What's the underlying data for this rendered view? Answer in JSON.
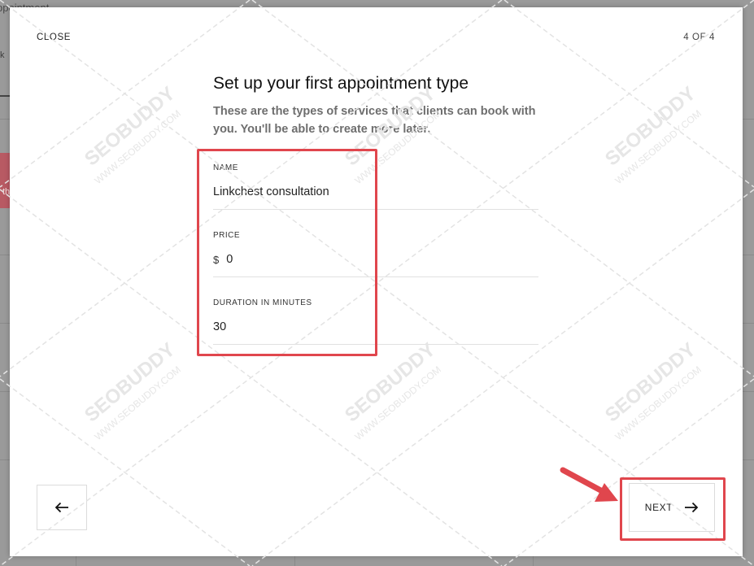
{
  "background": {
    "page_title": "ppointment",
    "tab_label": "k",
    "red_card_text": "th"
  },
  "header": {
    "close_label": "CLOSE",
    "step_indicator": "4 OF 4"
  },
  "main": {
    "title": "Set up your first appointment type",
    "subtitle": "These are the types of services that clients can book with you. You'll be able to create more later."
  },
  "fields": {
    "name": {
      "label": "NAME",
      "value": "Linkchest consultation"
    },
    "price": {
      "label": "PRICE",
      "currency": "$",
      "value": "0"
    },
    "duration": {
      "label": "DURATION IN MINUTES",
      "value": "30"
    }
  },
  "footer": {
    "back_icon": "arrow-left-icon",
    "next_label": "NEXT",
    "next_icon": "arrow-right-icon"
  },
  "watermark": {
    "brand": "SEOBUDDY",
    "url": "WWW.SEOBUDDY.COM"
  },
  "colors": {
    "highlight": "#e0464d",
    "overlay": "#8c8c8c",
    "subtitle": "#6e6e6e"
  }
}
